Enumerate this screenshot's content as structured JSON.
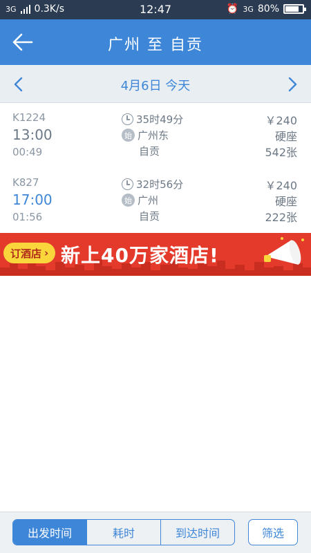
{
  "status_bar": {
    "network": "3G",
    "speed": "0.3K/s",
    "time": "12:47",
    "network_right": "3G",
    "battery": "80%",
    "battery_level": 0.8
  },
  "header": {
    "title": "广州 至 自贡",
    "back_icon": "arrow-left-icon"
  },
  "date_bar": {
    "label": "4月6日 今天"
  },
  "trains": [
    {
      "train_no": "K1224",
      "dep_time": "13:00",
      "arr_time": "00:49",
      "duration": "35时49分",
      "start_badge": "始",
      "from": "广州东",
      "to": "自贡",
      "price": "￥240",
      "seat": "硬座",
      "tickets": "542张"
    },
    {
      "train_no": "K827",
      "dep_time": "17:00",
      "arr_time": "01:56",
      "duration": "32时56分",
      "start_badge": "始",
      "from": "广州",
      "to": "自贡",
      "price": "￥240",
      "seat": "硬座",
      "tickets": "222张"
    }
  ],
  "colors": {
    "primary": "#3d86d8",
    "dep_time_first": "#6c7885",
    "dep_time_second": "#3d86d8",
    "banner": "#e43a2b"
  },
  "banner": {
    "button": "订酒店",
    "slogan": "新上40万家酒店!"
  },
  "bottom_bar": {
    "sort_options": [
      "出发时间",
      "耗时",
      "到达时间"
    ],
    "active_index": 0,
    "filter": "筛选"
  }
}
